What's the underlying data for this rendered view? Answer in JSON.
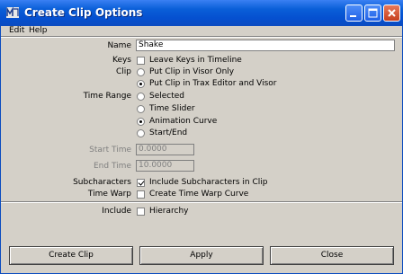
{
  "window": {
    "title": "Create Clip Options"
  },
  "menubar": {
    "items": [
      "Edit",
      "Help"
    ]
  },
  "form": {
    "name": {
      "label": "Name",
      "value": "Shake"
    },
    "keys": {
      "label": "Keys",
      "option": "Leave Keys in Timeline",
      "checked": false
    },
    "clip": {
      "label": "Clip",
      "options": [
        "Put Clip in Visor Only",
        "Put Clip in Trax Editor and Visor"
      ],
      "selected": 1
    },
    "time_range": {
      "label": "Time Range",
      "options": [
        "Selected",
        "Time Slider",
        "Animation Curve",
        "Start/End"
      ],
      "selected": 2
    },
    "start_time": {
      "label": "Start Time",
      "value": "0.0000"
    },
    "end_time": {
      "label": "End Time",
      "value": "10.0000"
    },
    "subcharacters": {
      "label": "Subcharacters",
      "option": "Include Subcharacters in Clip",
      "checked": true
    },
    "time_warp": {
      "label": "Time Warp",
      "option": "Create Time Warp Curve",
      "checked": false
    },
    "include": {
      "label": "Include",
      "option": "Hierarchy",
      "checked": false
    }
  },
  "buttons": {
    "create": "Create Clip",
    "apply": "Apply",
    "close": "Close"
  }
}
